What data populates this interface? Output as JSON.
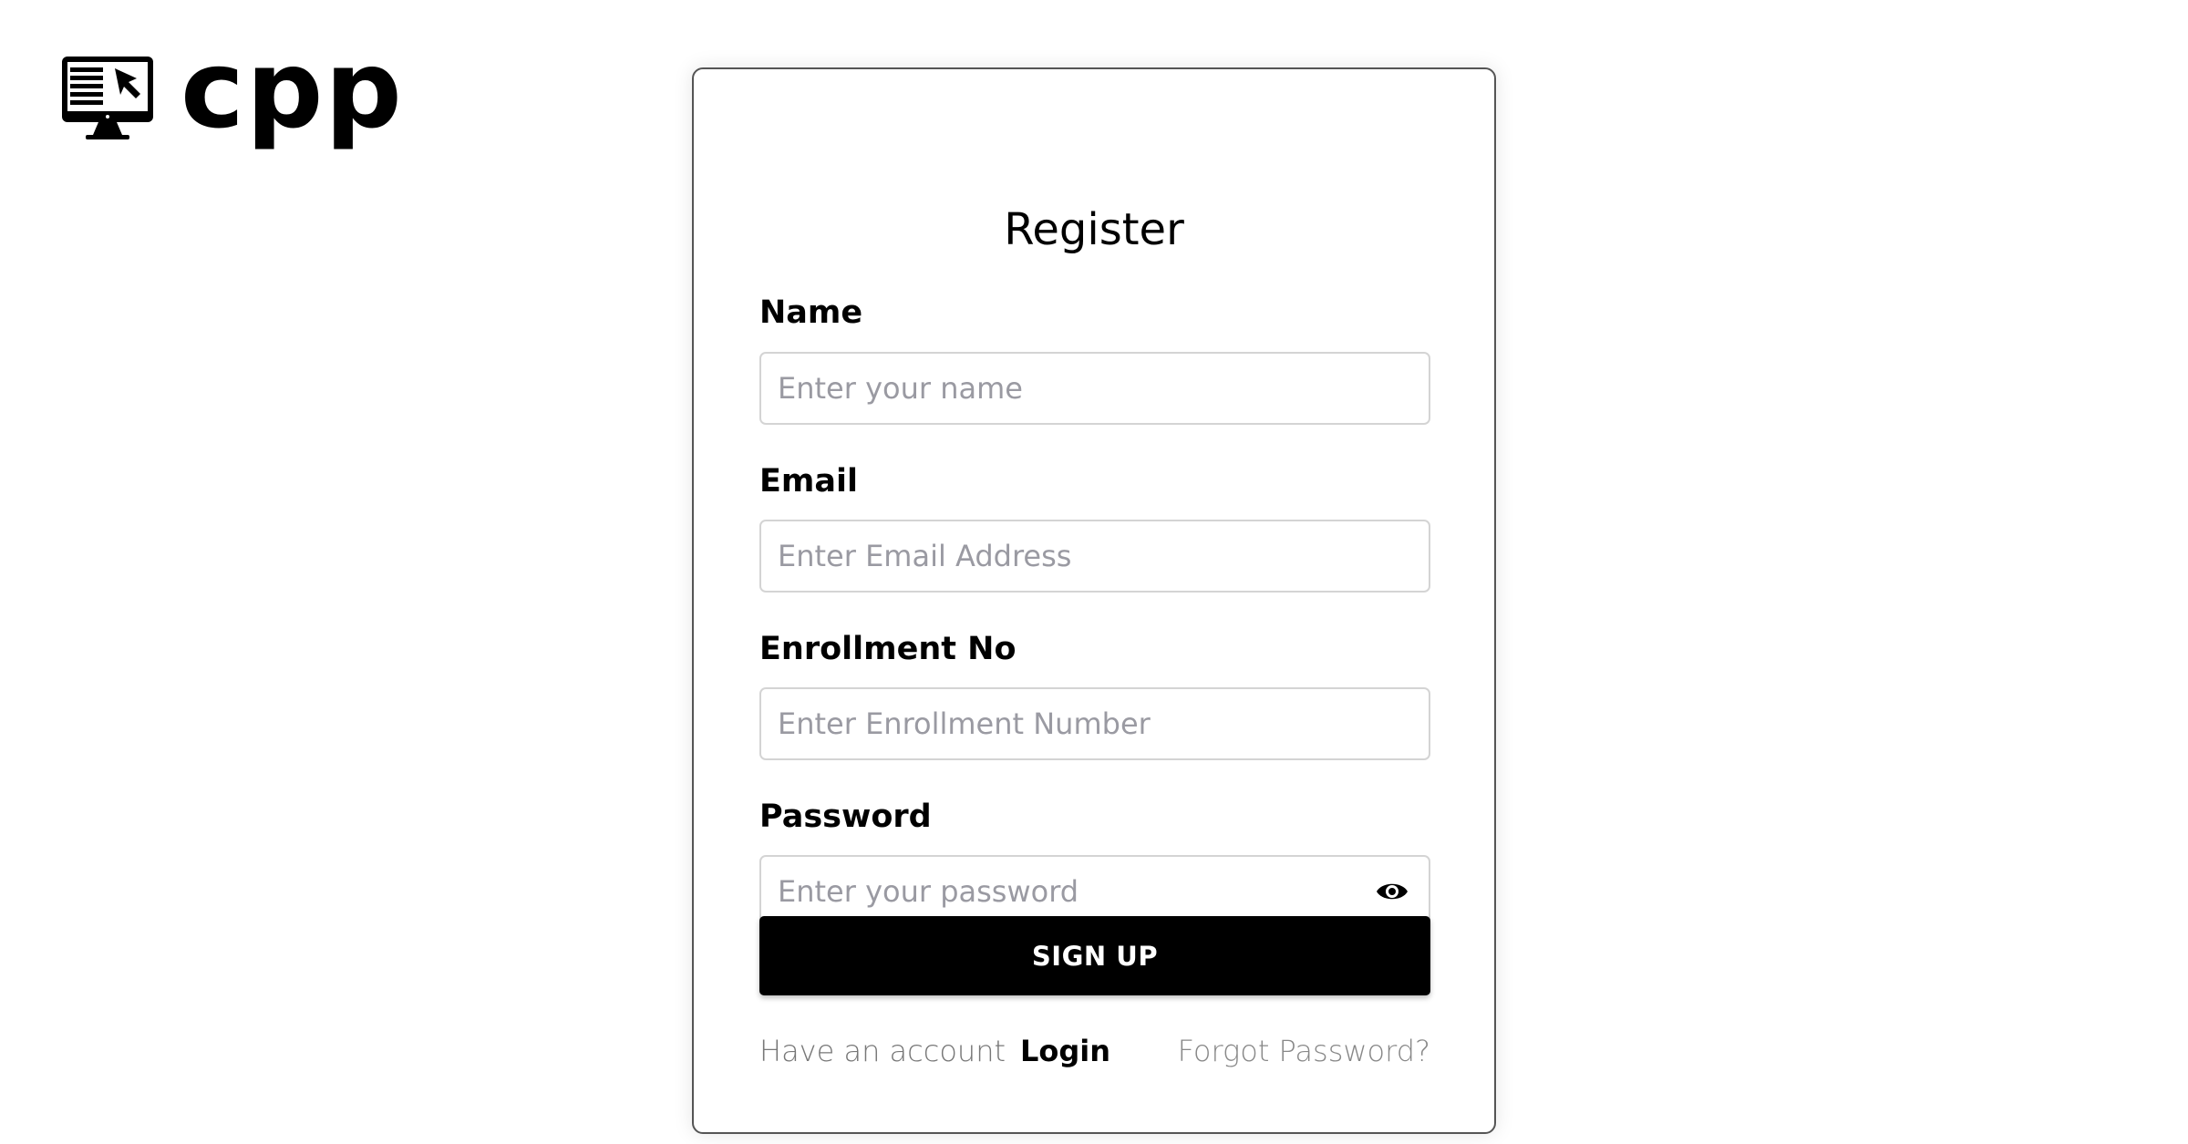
{
  "brand": {
    "name": "cpp",
    "icon": "monitor-cursor-icon"
  },
  "form": {
    "title": "Register",
    "fields": {
      "name": {
        "label": "Name",
        "placeholder": "Enter your name",
        "value": ""
      },
      "email": {
        "label": "Email",
        "placeholder": "Enter Email Address",
        "value": ""
      },
      "enrollment": {
        "label": "Enrollment No",
        "placeholder": "Enter Enrollment Number",
        "value": ""
      },
      "password": {
        "label": "Password",
        "placeholder": "Enter your password",
        "value": "",
        "toggle_icon": "eye-icon"
      }
    },
    "submit_label": "SIGN UP",
    "have_account_text": "Have an account",
    "login_label": "Login",
    "forgot_label": "Forgot Password?"
  },
  "colors": {
    "button_bg": "#000000",
    "button_text": "#ffffff",
    "input_border": "#d4d4d4",
    "card_border": "#555555",
    "placeholder": "#9a9aa2"
  }
}
